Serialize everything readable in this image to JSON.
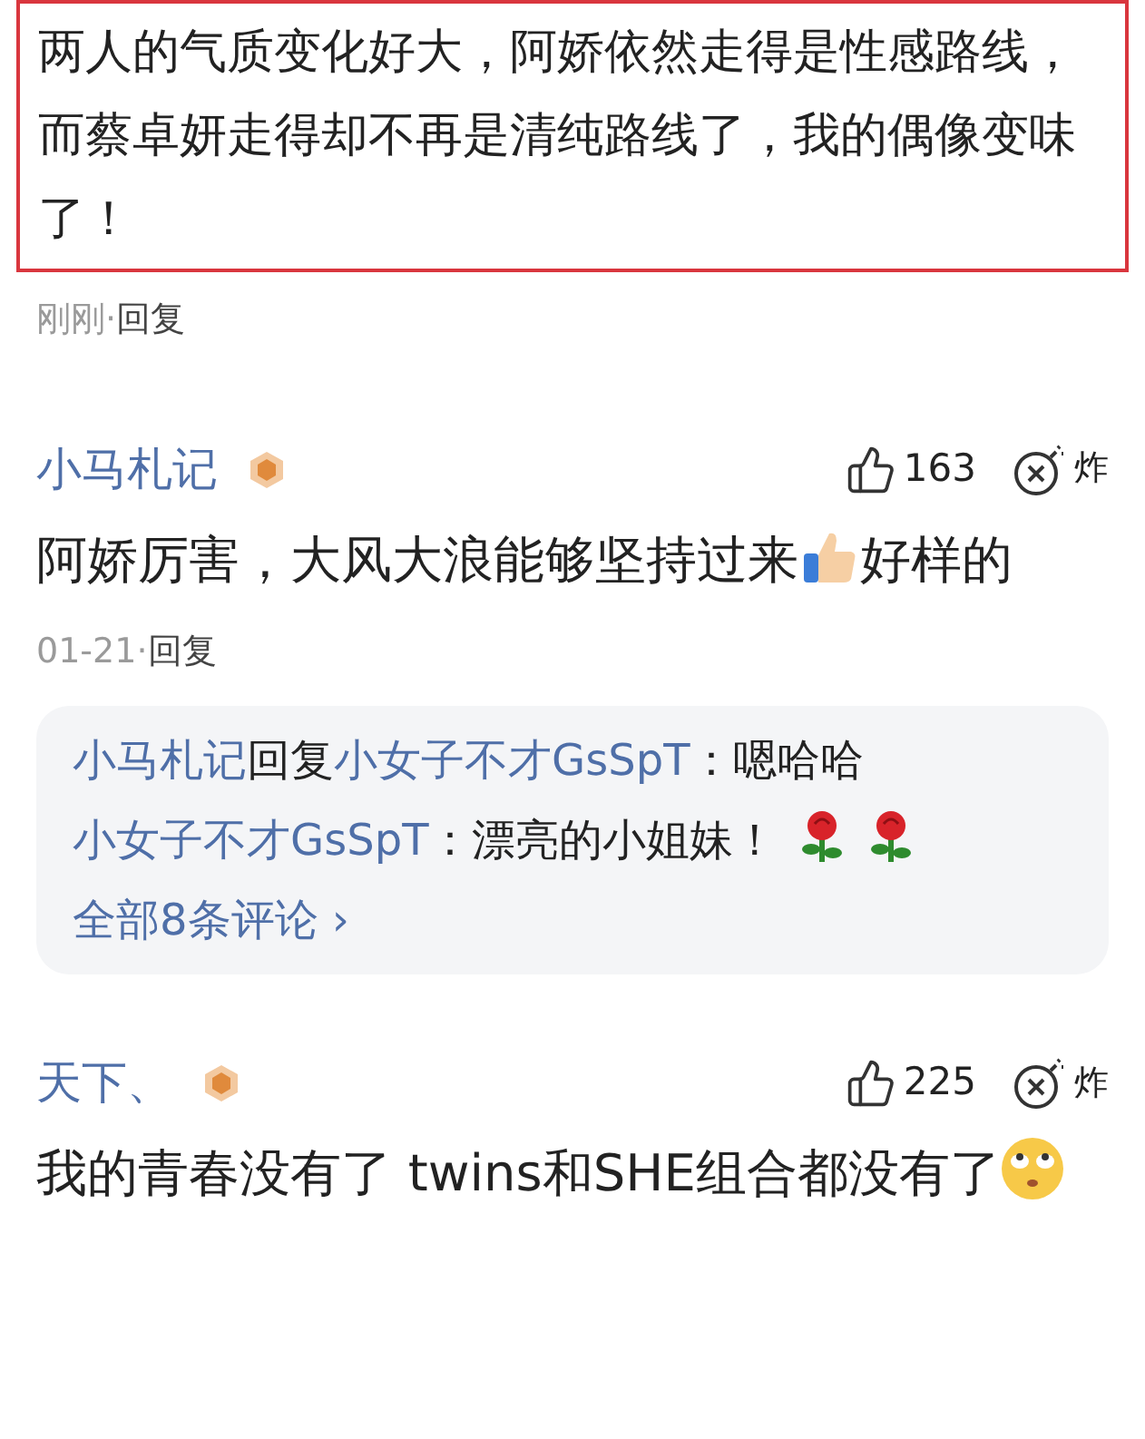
{
  "highlighted_comment": {
    "text": "两人的气质变化好大，阿娇依然走得是性感路线，而蔡卓妍走得却不再是清纯路线了，我的偶像变味了！",
    "time": "刚刚·",
    "reply": "回复"
  },
  "comments": [
    {
      "author": "小马札记",
      "likes": "163",
      "bury": "炸",
      "body": [
        {
          "kind": "text",
          "text": "阿娇厉害，大风大浪能够坚持过来"
        },
        {
          "kind": "thumbs_emoji"
        },
        {
          "kind": "text",
          "text": "好样的"
        }
      ],
      "time": "01-21·",
      "reply": "回复",
      "replies": {
        "lines": [
          [
            {
              "kind": "user",
              "text": "小马札记"
            },
            {
              "kind": "text",
              "text": "回复"
            },
            {
              "kind": "user",
              "text": "小女子不才GsSpT"
            },
            {
              "kind": "text",
              "text": "：嗯哈哈"
            }
          ],
          [
            {
              "kind": "user",
              "text": "小女子不才GsSpT"
            },
            {
              "kind": "text",
              "text": "：漂亮的小姐妹！"
            },
            {
              "kind": "rose_emoji"
            },
            {
              "kind": "rose_emoji"
            }
          ]
        ],
        "more": "全部8条评论",
        "more_arrow": "›"
      }
    },
    {
      "author": "天下、",
      "likes": "225",
      "bury": "炸",
      "body": [
        {
          "kind": "text",
          "text": "我的青春没有了 twins和SHE组合都没有了"
        },
        {
          "kind": "eyeroll_emoji"
        }
      ]
    }
  ]
}
